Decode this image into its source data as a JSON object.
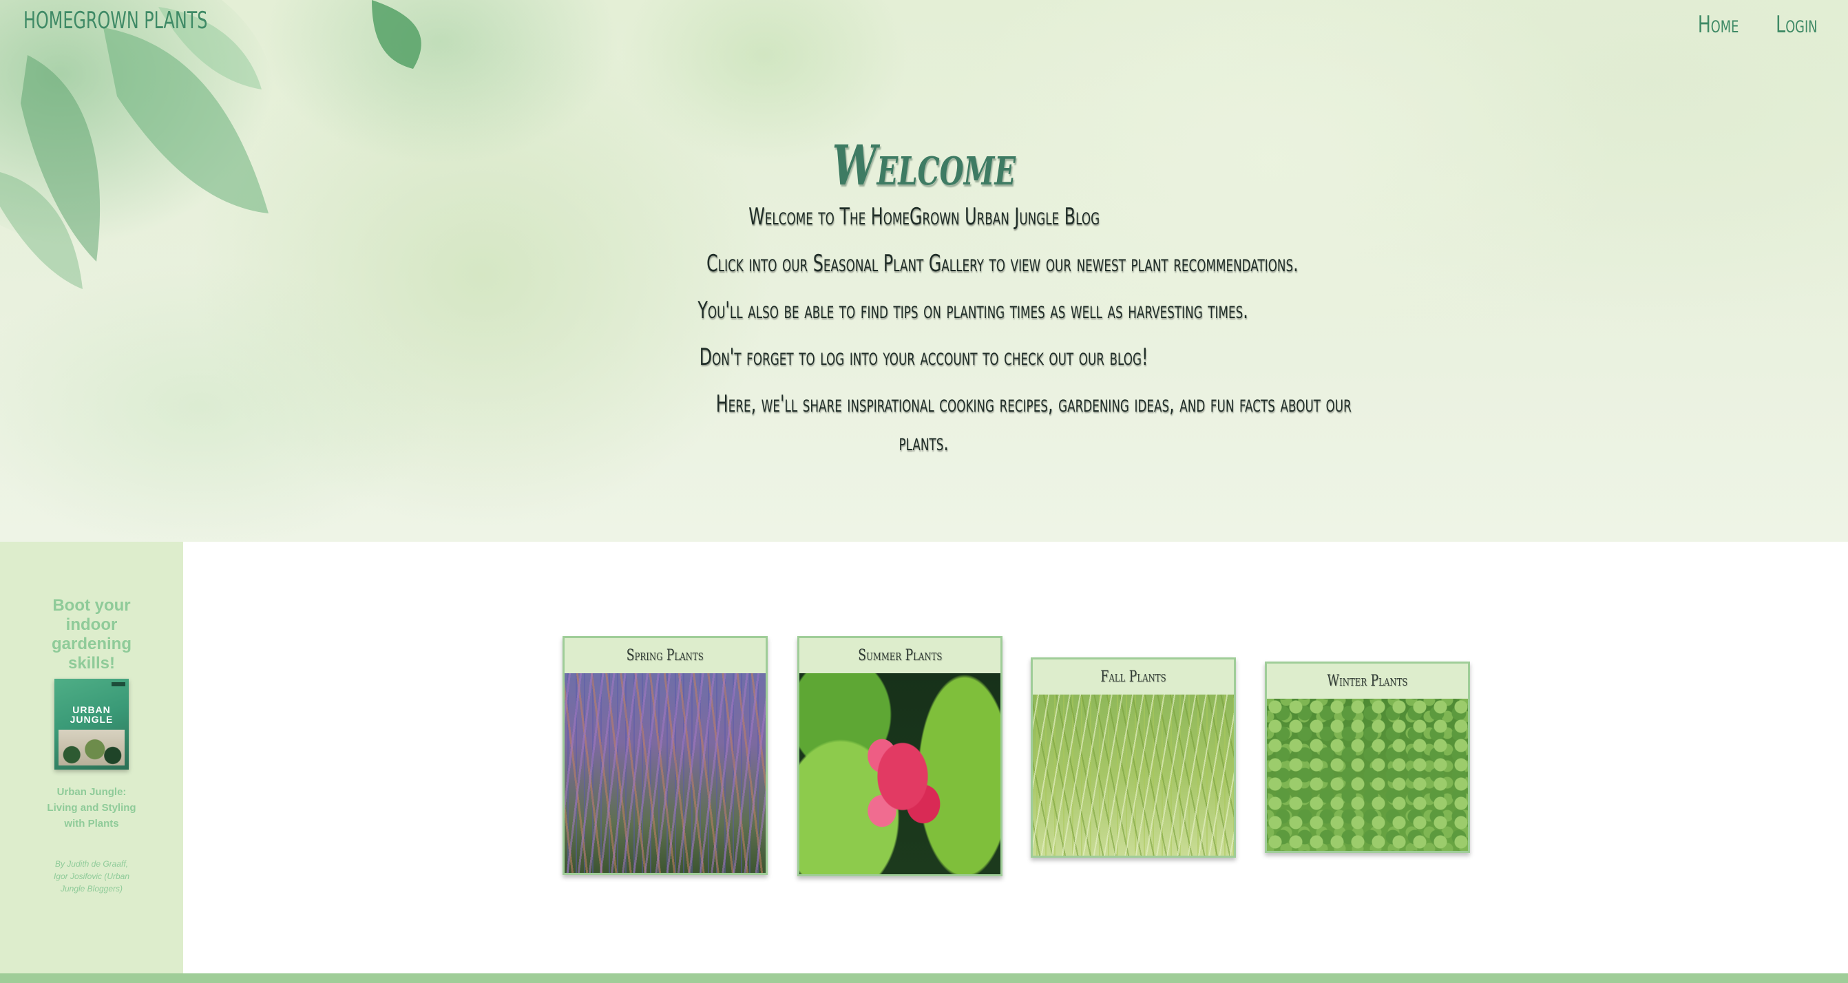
{
  "header": {
    "brand": "HOMEGROWN PLANTS",
    "nav": [
      {
        "label": "Home"
      },
      {
        "label": "Login"
      }
    ]
  },
  "hero": {
    "title": "Welcome",
    "lines": [
      "Welcome to The HomeGrown Urban Jungle Blog",
      "Click into our Seasonal Plant Gallery to view our newest plant recommendations.",
      "You'll also be able to find tips on planting times as well as harvesting times.",
      "Don't forget to log into your account to check out our blog!",
      "Here, we'll share inspirational cooking recipes, gardening ideas, and fun facts about our",
      "plants."
    ]
  },
  "sidebar": {
    "promo_title": "Boot your indoor gardening skills!",
    "book_cover_text": "URBAN JUNGLE",
    "book_name": "Urban Jungle: Living and Styling with Plants",
    "book_author": "By Judith de Graaff, Igor Josifovic (Urban Jungle Bloggers)"
  },
  "gallery": {
    "cards": [
      {
        "label": "Spring Plants",
        "image": "purple-salvia-flowers"
      },
      {
        "label": "Summer Plants",
        "image": "red-ginger-flower"
      },
      {
        "label": "Fall Plants",
        "image": "ornamental-grass"
      },
      {
        "label": "Winter Plants",
        "image": "ivy-leaves"
      }
    ]
  },
  "colors": {
    "brand_green": "#3f8a66",
    "sidebar_bg": "#ddedcc",
    "sidebar_text": "#8fcb99",
    "card_border": "#9fcd98",
    "footer_strip": "#9fcd98"
  }
}
